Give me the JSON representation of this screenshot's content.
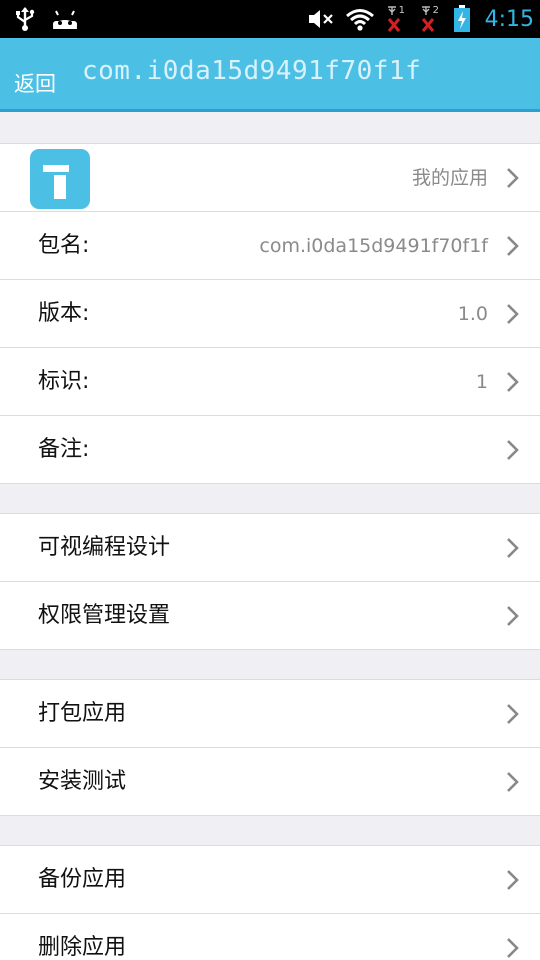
{
  "status_bar": {
    "time": "4:15",
    "icons": [
      "usb-icon",
      "android-icon",
      "mute-icon",
      "wifi-icon",
      "signal-1-no-service-icon",
      "signal-2-no-service-icon",
      "battery-charging-icon"
    ],
    "sim_labels": [
      "1",
      "2"
    ]
  },
  "header": {
    "back_label": "返回",
    "title": "com.i0da15d9491f70f1f"
  },
  "groups": [
    {
      "rows": [
        {
          "label": "",
          "value": "我的应用",
          "icon": "app-icon"
        },
        {
          "label": "包名:",
          "value": "com.i0da15d9491f70f1f"
        },
        {
          "label": "版本:",
          "value": "1.0"
        },
        {
          "label": "标识:",
          "value": "1"
        },
        {
          "label": "备注:",
          "value": ""
        }
      ]
    },
    {
      "rows": [
        {
          "label": "可视编程设计"
        },
        {
          "label": "权限管理设置"
        }
      ]
    },
    {
      "rows": [
        {
          "label": "打包应用"
        },
        {
          "label": "安装测试"
        }
      ]
    },
    {
      "rows": [
        {
          "label": "备份应用"
        },
        {
          "label": "删除应用"
        }
      ]
    }
  ],
  "colors": {
    "accent": "#4cc0e4",
    "background": "#efeff4",
    "clock": "#33b5e5"
  }
}
